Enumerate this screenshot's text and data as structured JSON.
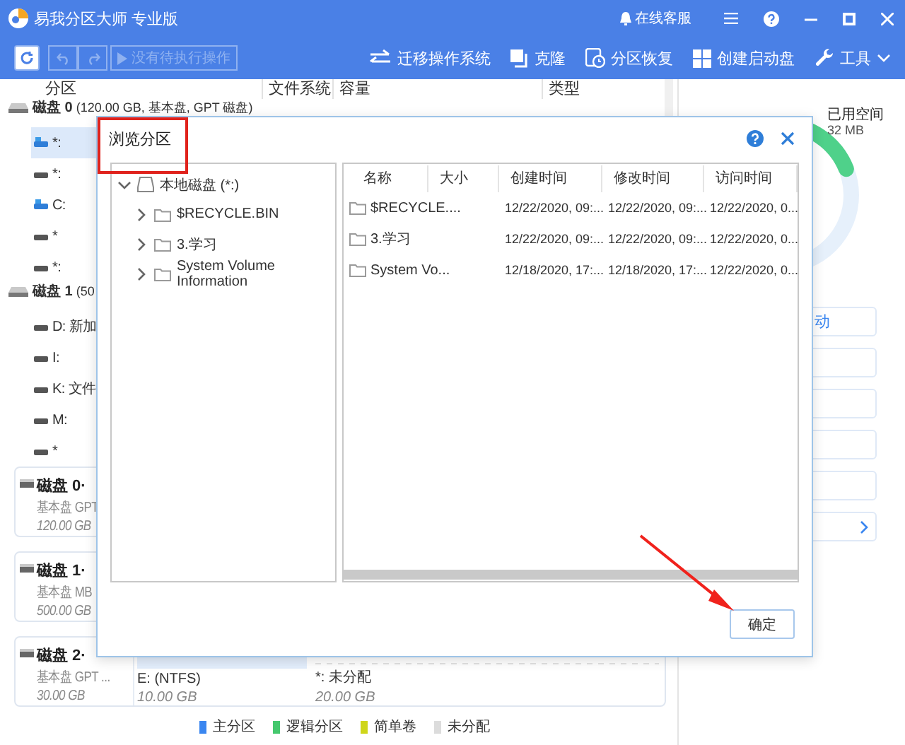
{
  "window": {
    "title": "易我分区大师 专业版",
    "support": "在线客服"
  },
  "toolbar": {
    "pending": {
      "label": "没有待执行操作",
      "disabled": true
    },
    "actions": [
      {
        "kind": "migrate",
        "label": "迁移操作系统"
      },
      {
        "kind": "clone",
        "label": "克隆"
      },
      {
        "kind": "recover",
        "label": "分区恢复"
      },
      {
        "kind": "bootdisk",
        "label": "创建启动盘"
      },
      {
        "kind": "tools",
        "label": "工具"
      }
    ]
  },
  "partition_table": {
    "columns": [
      "分区",
      "文件系统",
      "容量",
      "类型"
    ],
    "disks": [
      {
        "name": "磁盘 0",
        "info": "(120.00 GB, 基本盘, GPT 磁盘)",
        "partitions": [
          {
            "label": "*:",
            "kind": "system",
            "selected": true
          },
          {
            "label": "*:",
            "kind": "data",
            "selected": false
          },
          {
            "label": "C:",
            "kind": "system",
            "selected": false
          },
          {
            "label": "*",
            "kind": "data",
            "selected": false
          },
          {
            "label": "*:",
            "kind": "data",
            "selected": false
          }
        ]
      },
      {
        "name": "磁盘 1",
        "info": "(50",
        "partitions": [
          {
            "label": "D: 新加",
            "kind": "data",
            "selected": false
          },
          {
            "label": "I:",
            "kind": "data",
            "selected": false
          },
          {
            "label": "K: 文件",
            "kind": "data",
            "selected": false
          },
          {
            "label": "M:",
            "kind": "data",
            "selected": false
          },
          {
            "label": "*",
            "kind": "data",
            "selected": false
          }
        ]
      }
    ]
  },
  "disk_cards": [
    {
      "name": "磁盘 0·",
      "type": "基本盘 GPT",
      "size": "120.00 GB"
    },
    {
      "name": "磁盘 1·",
      "type": "基本盘 MB",
      "size": "500.00 GB"
    },
    {
      "name": "磁盘 2·",
      "type": "基本盘 GPT ...",
      "size": "30.00 GB",
      "partitions": [
        {
          "kind": "primary",
          "label": "E:",
          "fs": "(NTFS)",
          "size": "10.00 GB"
        },
        {
          "kind": "unallocated",
          "label": "*: 未分配",
          "size": "20.00 GB"
        }
      ]
    }
  ],
  "legend": [
    {
      "label": "主分区",
      "color": "#3a86f0"
    },
    {
      "label": "逻辑分区",
      "color": "#45c86e"
    },
    {
      "label": "简单卷",
      "color": "#cfd61a"
    },
    {
      "label": "未分配",
      "color": "#dcdcdc"
    }
  ],
  "side_panel": {
    "used_label": "已用空间",
    "used_value": "32 MB",
    "actions": [
      {
        "kind": "text",
        "label": "动"
      },
      {
        "kind": "plain"
      },
      {
        "kind": "plain"
      },
      {
        "kind": "plain"
      },
      {
        "kind": "plain"
      },
      {
        "kind": "expand"
      }
    ]
  },
  "dialog": {
    "title": "浏览分区",
    "tree": {
      "label": "本地磁盘 (*:)",
      "expanded": true,
      "children": [
        {
          "label": "$RECYCLE.BIN",
          "expanded": false
        },
        {
          "label": "3.学习",
          "expanded": false
        },
        {
          "label": "System Volume Information",
          "expanded": false
        }
      ]
    },
    "columns": [
      "名称",
      "大小",
      "创建时间",
      "修改时间",
      "访问时间"
    ],
    "rows": [
      {
        "name": "$RECYCLE....",
        "created": "12/22/2020, 09:...",
        "modified": "12/22/2020, 09:...",
        "accessed": "12/22/2020, 0..."
      },
      {
        "name": "3.学习",
        "created": "12/22/2020, 09:...",
        "modified": "12/22/2020, 09:...",
        "accessed": "12/22/2020, 0..."
      },
      {
        "name": "System Vo...",
        "created": "12/18/2020, 17:...",
        "modified": "12/18/2020, 17:...",
        "accessed": "12/22/2020, 0..."
      }
    ],
    "ok_button": "确定",
    "annotations": {
      "highlight_box": true,
      "arrow": true
    }
  }
}
